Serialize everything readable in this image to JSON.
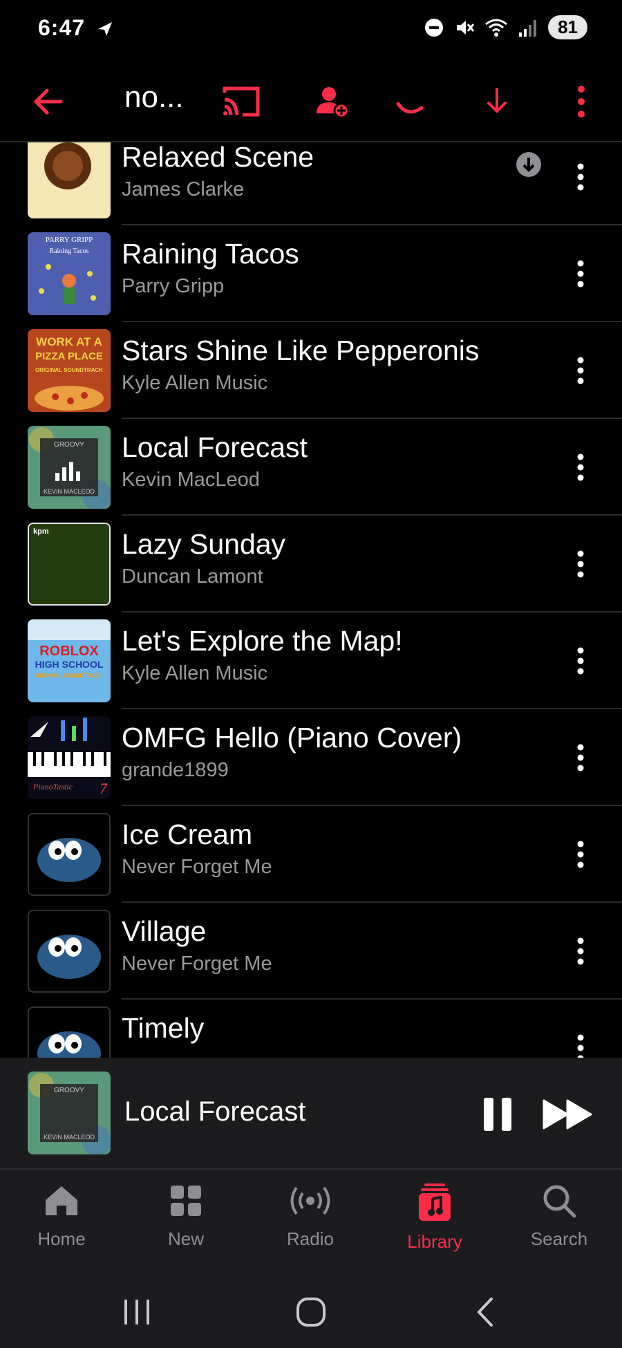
{
  "status": {
    "time": "6:47",
    "battery": "81"
  },
  "toolbar": {
    "title": "no..."
  },
  "colors": {
    "accent": "#fa2d48",
    "background": "#000000",
    "secondary_text": "#9a9a9a"
  },
  "songs": [
    {
      "title": "Relaxed Scene",
      "artist": "James Clarke",
      "downloaded": true
    },
    {
      "title": "Raining Tacos",
      "artist": "Parry Gripp"
    },
    {
      "title": "Stars Shine Like Pepperonis",
      "artist": "Kyle Allen Music"
    },
    {
      "title": "Local Forecast",
      "artist": "Kevin MacLeod"
    },
    {
      "title": "Lazy Sunday",
      "artist": "Duncan Lamont"
    },
    {
      "title": "Let's Explore the Map!",
      "artist": "Kyle Allen Music"
    },
    {
      "title": "OMFG Hello (Piano Cover)",
      "artist": "grande1899"
    },
    {
      "title": "Ice Cream",
      "artist": "Never Forget Me"
    },
    {
      "title": "Village",
      "artist": "Never Forget Me"
    },
    {
      "title": "Timely",
      "artist": ""
    }
  ],
  "artwork_text": {
    "parry": [
      "PARRY GRIPP",
      "Raining Tacos"
    ],
    "work": [
      "WORK AT A",
      "PIZZA PLACE",
      "ORIGINAL SOUNDTRACK"
    ],
    "groovy": [
      "GROOVY",
      "KEVIN MACLEOD"
    ],
    "kpm": "kpm",
    "roblox": [
      "ROBLOX",
      "HIGH SCHOOL",
      "ORIGINAL SOUNDTRACK"
    ],
    "piano": [
      "PianoTastic",
      "7"
    ]
  },
  "now_playing": {
    "title": "Local Forecast"
  },
  "tabs": [
    {
      "label": "Home",
      "icon": "house-icon"
    },
    {
      "label": "New",
      "icon": "grid-icon"
    },
    {
      "label": "Radio",
      "icon": "broadcast-icon"
    },
    {
      "label": "Library",
      "icon": "music-note-icon",
      "active": true
    },
    {
      "label": "Search",
      "icon": "search-icon"
    }
  ]
}
